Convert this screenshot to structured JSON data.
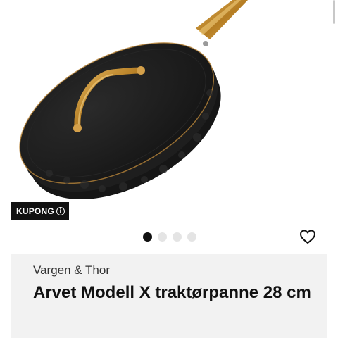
{
  "hero": {
    "image_name": "cast-iron-pan-with-lid",
    "badge_label": "KUPONG",
    "badge_icon": "info-icon",
    "carousel": {
      "count": 4,
      "active_index": 0
    },
    "favorite_icon": "heart-outline-icon"
  },
  "product": {
    "brand": "Vargen & Thor",
    "title": "Arvet Modell X traktørpanne 28 cm"
  },
  "colors": {
    "pan_body": "#1b1b1b",
    "handle_gold": "#c8912f",
    "card_bg": "#f2f2f2",
    "badge_bg": "#111111"
  }
}
